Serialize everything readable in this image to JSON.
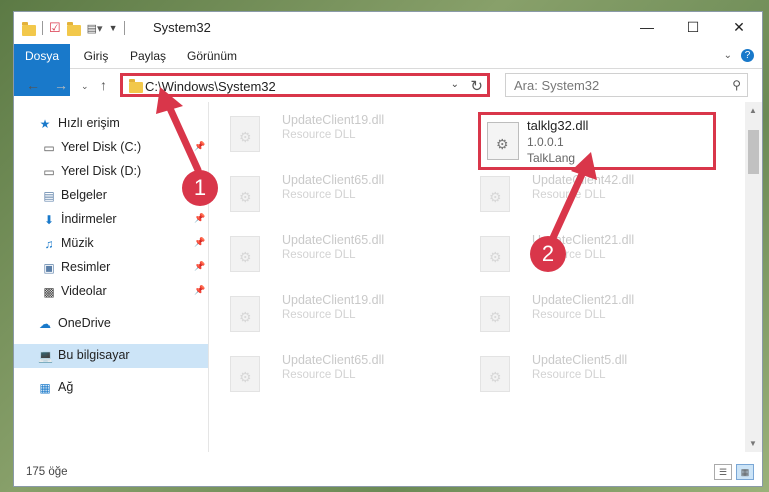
{
  "titlebar": {
    "title": "System32"
  },
  "ribbon": {
    "tabs": [
      "Dosya",
      "Giriş",
      "Paylaş",
      "Görünüm"
    ]
  },
  "address": {
    "path": "C:\\Windows\\System32"
  },
  "search": {
    "placeholder": "Ara: System32"
  },
  "sidebar": {
    "items": [
      {
        "label": "Hızlı erişim",
        "icon": "star-icon"
      },
      {
        "label": "Yerel Disk (C:)",
        "icon": "drive-icon"
      },
      {
        "label": "Yerel Disk (D:)",
        "icon": "drive-icon"
      },
      {
        "label": "Belgeler",
        "icon": "documents-icon"
      },
      {
        "label": "İndirmeler",
        "icon": "download-icon"
      },
      {
        "label": "Müzik",
        "icon": "music-icon"
      },
      {
        "label": "Resimler",
        "icon": "pictures-icon"
      },
      {
        "label": "Videolar",
        "icon": "video-icon"
      },
      {
        "label": "OneDrive",
        "icon": "cloud-icon"
      },
      {
        "label": "Bu bilgisayar",
        "icon": "computer-icon"
      },
      {
        "label": "Ağ",
        "icon": "network-icon"
      }
    ]
  },
  "files": [
    {
      "name": "UpdateClient19.dll",
      "type": "Resource DLL"
    },
    {
      "name": "UpdateClient65.dll",
      "type": "Resource DLL"
    },
    {
      "name": "UpdateClient42.dll",
      "type": "Resource DLL"
    },
    {
      "name": "UpdateClient65.dll",
      "type": "Resource DLL"
    },
    {
      "name": "UpdateClient21.dll",
      "type": "Resource DLL"
    },
    {
      "name": "UpdateClient19.dll",
      "type": "Resource DLL"
    },
    {
      "name": "UpdateClient21.dll",
      "type": "Resource DLL"
    },
    {
      "name": "UpdateClient65.dll",
      "type": "Resource DLL"
    },
    {
      "name": "UpdateClient5.dll",
      "type": "Resource DLL"
    }
  ],
  "highlighted_file": {
    "name": "talklg32.dll",
    "version": "1.0.0.1",
    "description": "TalkLang"
  },
  "status": {
    "count": "175 öğe"
  },
  "annotations": {
    "marker1": "1",
    "marker2": "2",
    "color": "#d9364a"
  }
}
